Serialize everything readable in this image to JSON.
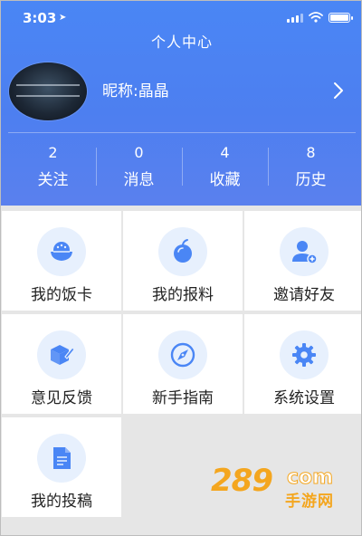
{
  "status_bar": {
    "time": "3:03"
  },
  "header": {
    "title": "个人中心",
    "nickname": "昵称:晶晶"
  },
  "stats": [
    {
      "count": "2",
      "label": "关注"
    },
    {
      "count": "0",
      "label": "消息"
    },
    {
      "count": "4",
      "label": "收藏"
    },
    {
      "count": "8",
      "label": "历史"
    }
  ],
  "menu": [
    {
      "label": "我的饭卡",
      "icon": "rice-bowl-icon"
    },
    {
      "label": "我的报料",
      "icon": "fruit-icon"
    },
    {
      "label": "邀请好友",
      "icon": "add-user-icon"
    },
    {
      "label": "意见反馈",
      "icon": "box-pencil-icon"
    },
    {
      "label": "新手指南",
      "icon": "compass-icon"
    },
    {
      "label": "系统设置",
      "icon": "gear-icon"
    },
    {
      "label": "我的投稿",
      "icon": "document-icon"
    }
  ],
  "watermark": {
    "number": "289",
    "domain": "com",
    "text": "手游网"
  },
  "colors": {
    "header_blue": "#4a86f5",
    "icon_blue": "#4a86f5",
    "icon_bg": "#e7f0fd",
    "watermark_orange": "#f4a61f"
  }
}
